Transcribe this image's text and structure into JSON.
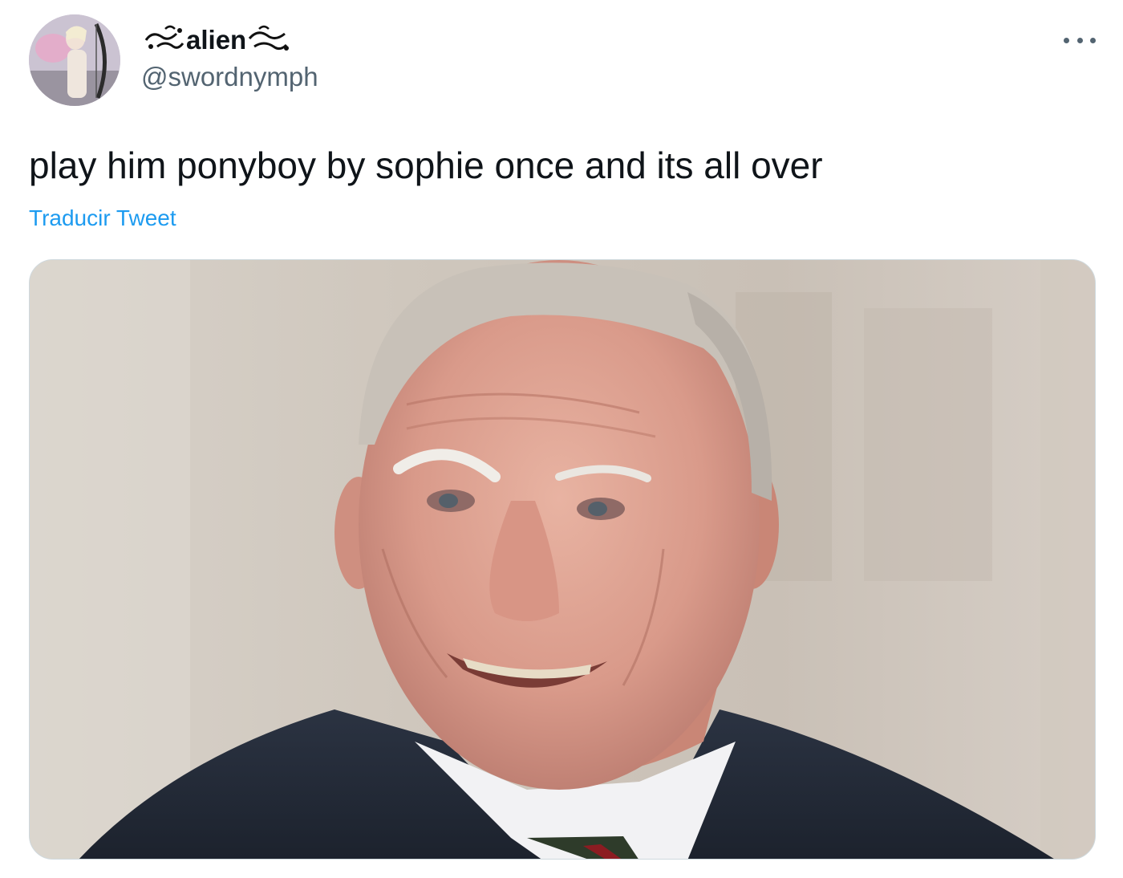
{
  "author": {
    "display_name": "alien",
    "handle": "@swordnymph",
    "avatar_icon": "profile-avatar"
  },
  "tweet": {
    "text": "play him ponyboy by sophie once and its all over",
    "translate_label": "Traducir Tweet"
  },
  "menu": {
    "icon": "more-options-icon"
  },
  "media": {
    "icon": "photo"
  },
  "colors": {
    "text": "#0f1419",
    "secondary": "#536471",
    "link": "#1d9bf0",
    "border": "#cfd9de"
  }
}
